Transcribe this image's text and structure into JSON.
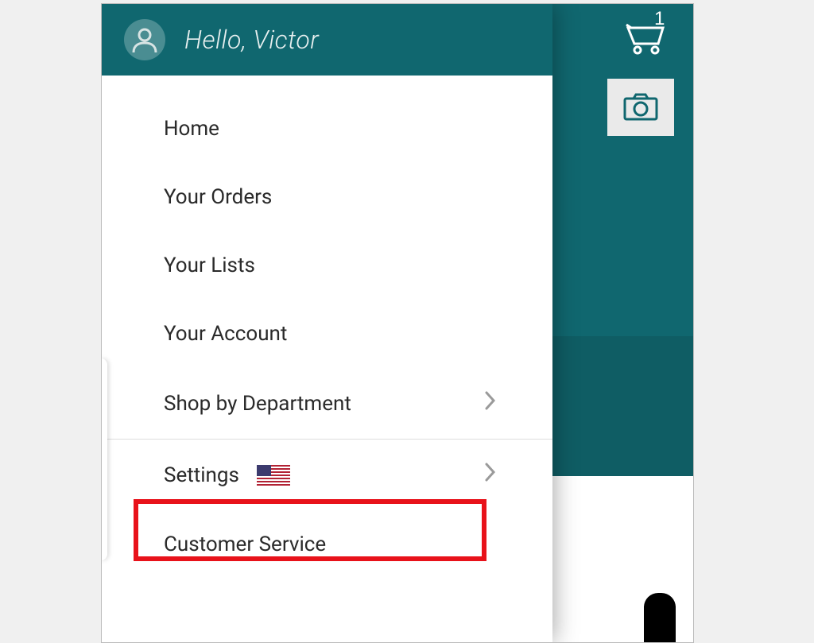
{
  "greeting": "Hello, Victor",
  "cart_count": "1",
  "menu": {
    "home": "Home",
    "orders": "Your Orders",
    "lists": "Your Lists",
    "account": "Your Account",
    "shop_dept": "Shop by Department",
    "settings": "Settings",
    "customer_service": "Customer Service"
  }
}
